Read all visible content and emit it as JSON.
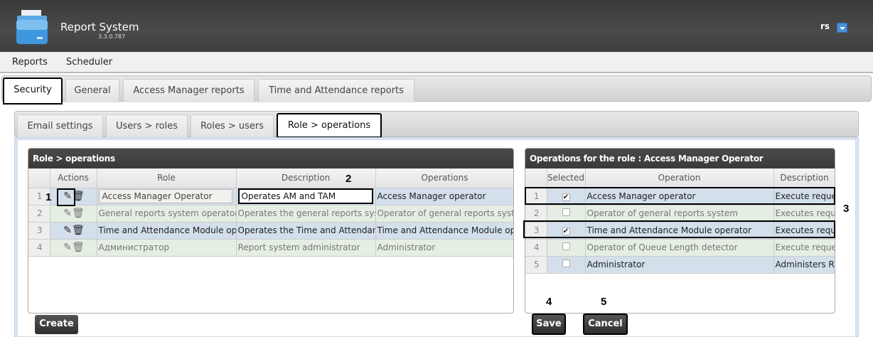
{
  "header": {
    "title": "Report System",
    "version": "3.3.0.787",
    "user": "rs",
    "logo_icon": "folder-icon"
  },
  "menu": [
    "Reports",
    "Scheduler"
  ],
  "main_tabs": [
    {
      "label": "Security",
      "active": true
    },
    {
      "label": "General"
    },
    {
      "label": "Access Manager reports"
    },
    {
      "label": "Time and Attendance reports"
    }
  ],
  "sub_tabs": [
    {
      "label": "Email settings"
    },
    {
      "label": "Users > roles"
    },
    {
      "label": "Roles > users"
    },
    {
      "label": "Role > operations",
      "active": true
    }
  ],
  "roles_grid": {
    "title": "Role > operations",
    "columns": [
      "",
      "Actions",
      "Role",
      "Description",
      "Operations"
    ],
    "rows": [
      {
        "n": "1",
        "role": "Access Manager Operator",
        "description": "Operates AM and TAM",
        "operations": "Access Manager operator",
        "editing": true
      },
      {
        "n": "2",
        "role": "General reports system operator",
        "description": "Operates the general reports system",
        "operations": "Operator of general reports system"
      },
      {
        "n": "3",
        "role": "Time and Attendance Module operator",
        "description": "Operates the Time and Attendance",
        "operations": "Time and Attendance Module operator"
      },
      {
        "n": "4",
        "role": "Администратор",
        "description": "Report system administrator",
        "operations": "Administrator"
      }
    ],
    "create_label": "Create"
  },
  "ops_grid": {
    "title": "Operations for the role : Access Manager Operator",
    "columns": [
      "",
      "Selected",
      "Operation",
      "Description"
    ],
    "rows": [
      {
        "n": "1",
        "selected": true,
        "operation": "Access Manager operator",
        "description": "Execute reques"
      },
      {
        "n": "2",
        "selected": false,
        "operation": "Operator of general reports system",
        "description": "Executes reque"
      },
      {
        "n": "3",
        "selected": true,
        "operation": "Time and Attendance Module operator",
        "description": "Executes reque"
      },
      {
        "n": "4",
        "selected": false,
        "operation": "Operator of Queue Length detector",
        "description": "Execute reques"
      },
      {
        "n": "5",
        "selected": false,
        "operation": "Administrator",
        "description": "Administers Re"
      }
    ],
    "save_label": "Save",
    "cancel_label": "Cancel"
  },
  "annotations": [
    "1",
    "2",
    "3",
    "4",
    "5"
  ]
}
